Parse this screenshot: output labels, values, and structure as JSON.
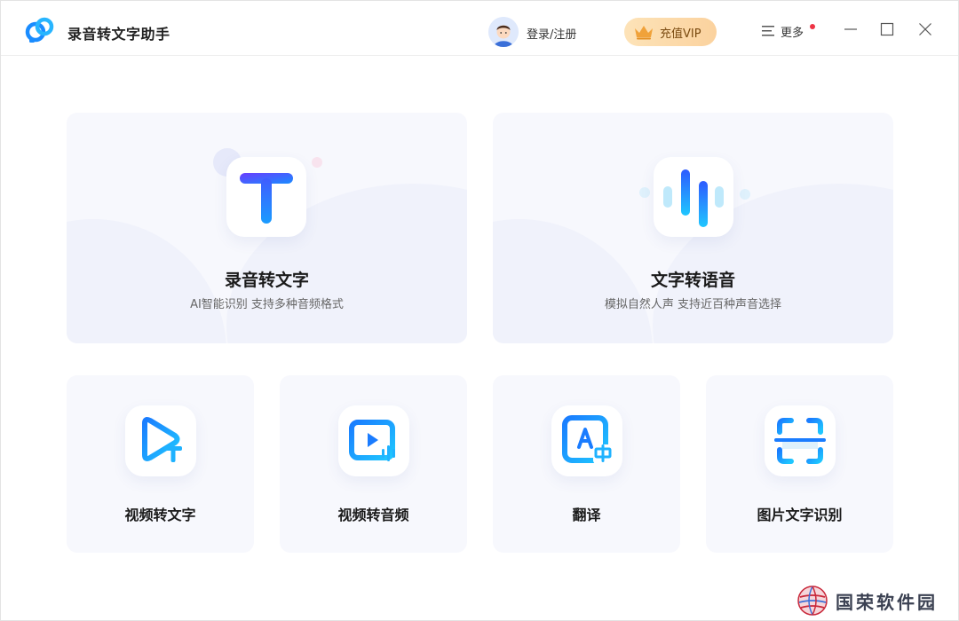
{
  "app": {
    "title": "录音转文字助手"
  },
  "header": {
    "login_label": "登录/注册",
    "vip_label": "充值VIP",
    "more_label": "更多",
    "accent": "#1a7cff",
    "vip_bg": "#fbd29e"
  },
  "features": {
    "audio_to_text": {
      "title": "录音转文字",
      "subtitle": "AI智能识别 支持多种音频格式",
      "icon": "text-t-icon"
    },
    "text_to_speech": {
      "title": "文字转语音",
      "subtitle": "模拟自然人声 支持近百种声音选择",
      "icon": "soundwave-icon"
    },
    "video_to_text": {
      "title": "视频转文字",
      "icon": "video-text-icon"
    },
    "video_to_audio": {
      "title": "视频转音频",
      "icon": "video-audio-icon"
    },
    "translate": {
      "title": "翻译",
      "icon": "translate-icon"
    },
    "image_ocr": {
      "title": "图片文字识别",
      "icon": "scan-icon"
    }
  },
  "watermark": {
    "label": "国荣软件园"
  }
}
